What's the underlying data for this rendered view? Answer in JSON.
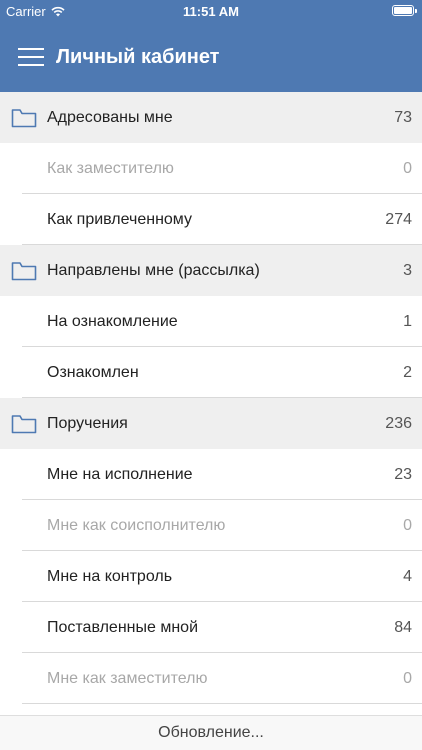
{
  "status": {
    "carrier": "Carrier",
    "time": "11:51 AM"
  },
  "header": {
    "title": "Личный кабинет"
  },
  "sections": [
    {
      "label": "Адресованы мне",
      "count": "73",
      "items": [
        {
          "label": "Как заместителю",
          "count": "0",
          "disabled": true
        },
        {
          "label": "Как привлеченному",
          "count": "274",
          "disabled": false
        }
      ]
    },
    {
      "label": "Направлены мне (рассылка)",
      "count": "3",
      "items": [
        {
          "label": "На ознакомление",
          "count": "1",
          "disabled": false
        },
        {
          "label": "Ознакомлен",
          "count": "2",
          "disabled": false
        }
      ]
    },
    {
      "label": "Поручения",
      "count": "236",
      "items": [
        {
          "label": "Мне на исполнение",
          "count": "23",
          "disabled": false
        },
        {
          "label": "Мне как соисполнителю",
          "count": "0",
          "disabled": true
        },
        {
          "label": "Мне на контроль",
          "count": "4",
          "disabled": false
        },
        {
          "label": "Поставленные мной",
          "count": "84",
          "disabled": false
        },
        {
          "label": "Мне как заместителю",
          "count": "0",
          "disabled": true
        }
      ]
    }
  ],
  "footer": {
    "text": "Обновление..."
  },
  "colors": {
    "accent": "#4e79b2",
    "section_bg": "#efefef",
    "disabled": "#a8a8a8"
  }
}
